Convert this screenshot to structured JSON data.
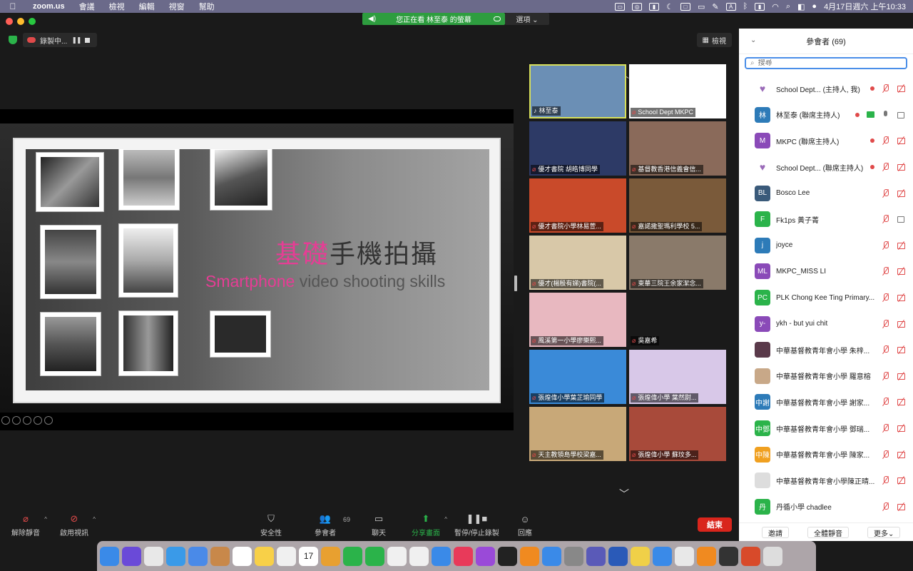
{
  "menubar": {
    "app": "zoom.us",
    "items": [
      "會議",
      "檢視",
      "編輯",
      "視窗",
      "幫助"
    ],
    "status_a": "A",
    "clock": "4月17日週六 上午10:33"
  },
  "banner": {
    "viewing": "您正在看 林至泰 的螢幕",
    "options": "選項 ⌄"
  },
  "recording": {
    "label": "錄製中..."
  },
  "view_button": "檢視",
  "slide": {
    "title_pink": "基礎",
    "title_rest": "手機拍攝",
    "subtitle_pink": "Smartphone",
    "subtitle_rest": " video shooting skills"
  },
  "gallery": [
    {
      "name": "林至泰",
      "muted": false,
      "color": "#6b8fb5"
    },
    {
      "name": "School Dept MKPC",
      "muted": true,
      "color": "#ffffff"
    },
    {
      "name": "優才書院 胡皓博同學",
      "muted": true,
      "color": "#2d3a66"
    },
    {
      "name": "基督教香港信義會信...",
      "muted": true,
      "color": "#8a6a5a"
    },
    {
      "name": "優才書院小學林易萱...",
      "muted": true,
      "color": "#c94a2a"
    },
    {
      "name": "嘉諾撒聖瑪利學校 5...",
      "muted": true,
      "color": "#7a5a3a"
    },
    {
      "name": "優才(楊殷有娣)書院(...",
      "muted": true,
      "color": "#d8c8a8"
    },
    {
      "name": "東華三院王余家潔念...",
      "muted": true,
      "color": "#8a7a6a"
    },
    {
      "name": "風溪第一小學廖樂熙...",
      "muted": true,
      "color": "#e8b8c0"
    },
    {
      "name": "吳嘉希",
      "muted": true,
      "color": "#1a1a1a"
    },
    {
      "name": "張煌偉小學葉芷瑜同學",
      "muted": true,
      "color": "#3a8ad8"
    },
    {
      "name": "張煌偉小學 葉然尉...",
      "muted": true,
      "color": "#d8c8e8"
    },
    {
      "name": "天主教領島學校梁嘉...",
      "muted": true,
      "color": "#c8a878"
    },
    {
      "name": "張煌偉小學 蘇玟多...",
      "muted": true,
      "color": "#a84a3a"
    }
  ],
  "toolbar": {
    "unmute": "解除靜音",
    "start_video": "啟用視訊",
    "security": "安全性",
    "participants": "參會者",
    "participants_count": "69",
    "chat": "聊天",
    "share": "分享畫面",
    "pause_rec": "暫停/停止錄製",
    "reactions": "回應",
    "end": "結束"
  },
  "panel": {
    "title": "參會者 (69)",
    "search_placeholder": "搜尋",
    "invite": "邀請",
    "mute_all": "全體靜音",
    "more": "更多⌄"
  },
  "participants": [
    {
      "name": "School Dept...   (主持人, 我)",
      "initials": "♥",
      "color": "#ffffff",
      "fg": "#9a6ab8",
      "rec": true,
      "mic": "off",
      "cam": "off"
    },
    {
      "name": "林至泰 (聯席主持人)",
      "initials": "林",
      "color": "#2d7bb8",
      "fg": "#ffffff",
      "rec": true,
      "share": true,
      "mic": "on",
      "cam": "on"
    },
    {
      "name": "MKPC (聯席主持人)",
      "initials": "M",
      "color": "#8a4ab8",
      "fg": "#ffffff",
      "rec": true,
      "mic": "off",
      "cam": "off"
    },
    {
      "name": "School Dept...  (聯席主持人)",
      "initials": "♥",
      "color": "#ffffff",
      "fg": "#9a6ab8",
      "rec": true,
      "mic": "off",
      "cam": "off"
    },
    {
      "name": "Bosco Lee",
      "initials": "BL",
      "color": "#3a5a7a",
      "fg": "#ffffff",
      "mic": "off",
      "cam": "off"
    },
    {
      "name": "Fk1ps 黃子菁",
      "initials": "F",
      "color": "#2bb34a",
      "fg": "#ffffff",
      "mic": "off",
      "cam": "on"
    },
    {
      "name": "joyce",
      "initials": "j",
      "color": "#2d7bb8",
      "fg": "#ffffff",
      "mic": "off",
      "cam": "off"
    },
    {
      "name": "MKPC_MISS LI",
      "initials": "ML",
      "color": "#8a4ab8",
      "fg": "#ffffff",
      "mic": "off",
      "cam": "off"
    },
    {
      "name": "PLK Chong Kee Ting Primary...",
      "initials": "PC",
      "color": "#2bb34a",
      "fg": "#ffffff",
      "mic": "off",
      "cam": "off"
    },
    {
      "name": "ykh - but yui chit",
      "initials": "y-",
      "color": "#8a4ab8",
      "fg": "#ffffff",
      "mic": "off",
      "cam": "off"
    },
    {
      "name": "中華基督教青年會小學 朱梓...",
      "initials": "",
      "color": "#5a3a4a",
      "fg": "#ffffff",
      "mic": "off",
      "cam": "off"
    },
    {
      "name": "中華基督教青年會小學 羅意榕",
      "initials": "",
      "color": "#c8a888",
      "fg": "#ffffff",
      "mic": "off",
      "cam": "off"
    },
    {
      "name": "中華基督教青年會小學 謝家...",
      "initials": "中謝",
      "color": "#2d7bb8",
      "fg": "#ffffff",
      "mic": "off",
      "cam": "off"
    },
    {
      "name": "中華基督教青年會小學 鄧瑞...",
      "initials": "中鄧",
      "color": "#2bb34a",
      "fg": "#ffffff",
      "mic": "off",
      "cam": "off"
    },
    {
      "name": "中華基督教青年會小學 陳家...",
      "initials": "中陳",
      "color": "#f0a020",
      "fg": "#ffffff",
      "mic": "off",
      "cam": "off"
    },
    {
      "name": "中華基督教青年會小學陳正晴...",
      "initials": "",
      "color": "#dddddd",
      "fg": "#333333",
      "mic": "off",
      "cam": "off"
    },
    {
      "name": "丹循小學 chadlee",
      "initials": "丹",
      "color": "#2bb34a",
      "fg": "#ffffff",
      "mic": "off",
      "cam": "off"
    }
  ],
  "calendar_day": "17",
  "dock_colors": [
    "#3a8ae8",
    "#6a4ad8",
    "#e8e8e8",
    "#3a9ae8",
    "#4a8ae8",
    "#c8884a",
    "#ffffff",
    "#f8d048",
    "#f0f0f0",
    "#2bb34a",
    "#e8a030",
    "#2bb34a",
    "#2bb34a",
    "#f0f0f0",
    "#f0f0f0",
    "#3a8ae8",
    "#e83a5a",
    "#9a4ad8",
    "#222222",
    "#f08a20",
    "#3a8ae8",
    "#888888",
    "#5a5ab8",
    "#2a5ab8",
    "#f0d048",
    "#3a8ae8",
    "#e8e8e8",
    "#f08a20",
    "#333333",
    "#d84a2a",
    "#dddddd"
  ]
}
